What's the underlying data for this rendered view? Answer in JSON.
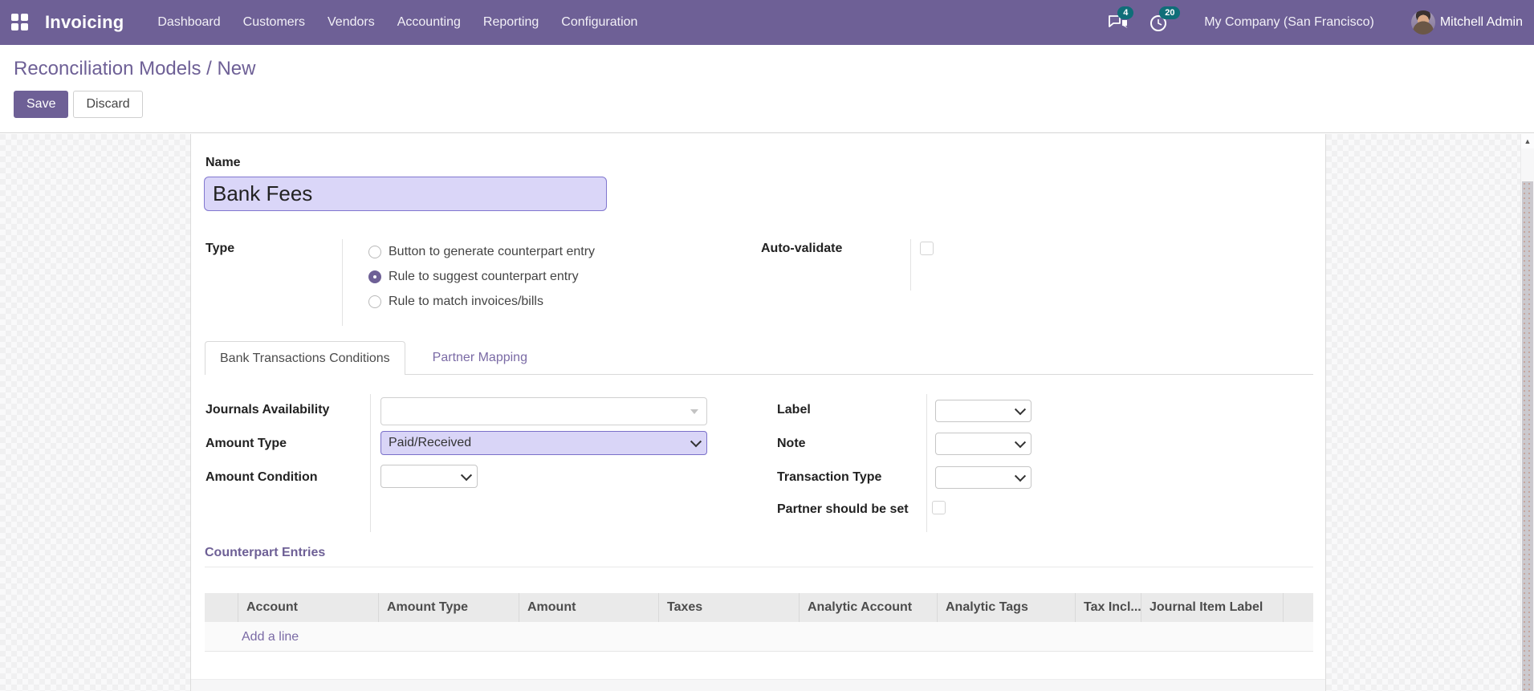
{
  "app": {
    "name": "Invoicing",
    "menu_items": [
      "Dashboard",
      "Customers",
      "Vendors",
      "Accounting",
      "Reporting",
      "Configuration"
    ],
    "messages_count": "4",
    "activities_count": "20",
    "company_name": "My Company (San Francisco)",
    "user_name": "Mitchell Admin"
  },
  "control_panel": {
    "breadcrumb": "Reconciliation Models / New",
    "save_label": "Save",
    "discard_label": "Discard"
  },
  "form": {
    "name": {
      "label": "Name",
      "value": "Bank Fees"
    },
    "type": {
      "label": "Type",
      "options": [
        {
          "label": "Button to generate counterpart entry",
          "selected": false
        },
        {
          "label": "Rule to suggest counterpart entry",
          "selected": true
        },
        {
          "label": "Rule to match invoices/bills",
          "selected": false
        }
      ]
    },
    "auto_validate": {
      "label": "Auto-validate",
      "checked": false
    },
    "tabs": [
      {
        "label": "Bank Transactions Conditions",
        "active": true
      },
      {
        "label": "Partner Mapping",
        "active": false
      }
    ],
    "conditions": {
      "journals_availability": {
        "label": "Journals Availability",
        "value": ""
      },
      "amount_type": {
        "label": "Amount Type",
        "value": "Paid/Received"
      },
      "amount_condition": {
        "label": "Amount Condition",
        "value": ""
      },
      "label": {
        "label": "Label",
        "value": ""
      },
      "note": {
        "label": "Note",
        "value": ""
      },
      "transaction_type": {
        "label": "Transaction Type",
        "value": ""
      },
      "partner_should_be_set": {
        "label": "Partner should be set",
        "checked": false
      }
    },
    "counterpart_entries": {
      "heading": "Counterpart Entries",
      "columns": [
        "Account",
        "Amount Type",
        "Amount",
        "Taxes",
        "Analytic Account",
        "Analytic Tags",
        "Tax Incl...",
        "Journal Item Label"
      ],
      "add_line_label": "Add a line"
    }
  },
  "colors": {
    "navbar": "#6e6096",
    "badge": "#0f6e78",
    "accent": "#6e6096",
    "highlight_bg": "#d9d5f7",
    "highlight_border": "#7a70c9"
  }
}
